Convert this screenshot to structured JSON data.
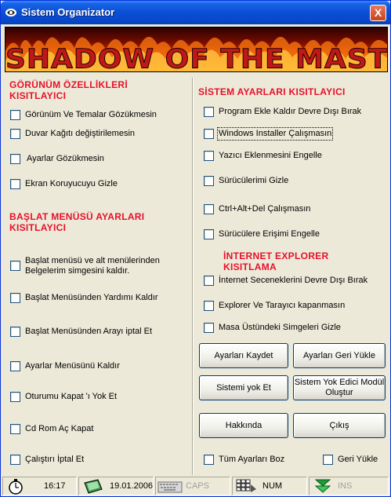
{
  "window": {
    "title": "Sistem Organizator",
    "close_label": "X"
  },
  "banner": {
    "text": "SHADOW OF THE MASTER"
  },
  "left": {
    "section1_title_line1": "GÖRÜNÜM ÖZELLİKLERİ",
    "section1_title_line2": "KISITLAYICI",
    "section1_items": [
      "Görünüm Ve Temalar Gözükmesin",
      "Duvar Kağıtı değiştirilemesin",
      "Ayarlar Gözükmesin",
      "Ekran Koruyucuyu Gizle"
    ],
    "section2_title_line1": "BAŞLAT MENÜSÜ AYARLARI",
    "section2_title_line2": "KISITLAYICI",
    "section2_item0_line1": "Başlat menüsü ve alt menülerinden",
    "section2_item0_line2": "Belgelerim simgesini kaldır.",
    "section2_items": [
      "Başlat Menüsünden Yardımı Kaldır",
      "Başlat Menüsünden Arayı iptal Et",
      "Ayarlar Menüsünü Kaldır",
      "Oturumu Kapat 'ı Yok Et",
      "Cd Rom Aç Kapat",
      "Çalıştırı İptal Et"
    ]
  },
  "right": {
    "section1_title": "SİSTEM AYARLARI KISITLAYICI",
    "section1_items": [
      "Program Ekle Kaldır  Devre Dışı Bırak",
      "Windows Installer Çalışmasın",
      "Yazıcı Eklenmesini Engelle",
      "Sürücülerimi Gizle",
      "Ctrl+Alt+Del Çalışmasın",
      "Sürücülere Erişimi Engelle"
    ],
    "section2_title_line1": "İNTERNET EXPLORER",
    "section2_title_line2": "KISITLAMA",
    "section2_items": [
      "İnternet Seceneklerini Devre Dışı Bırak",
      "Explorer Ve Tarayıcı kapanmasın",
      "Masa Üstündeki Simgeleri Gizle"
    ],
    "buttons": {
      "save": "Ayarları Kaydet",
      "restore": "Ayarları Geri Yükle",
      "destroy": "Sistemi yok Et",
      "create_line1": "Sistem Yok Edici Modül",
      "create_line2": "Oluştur",
      "about": "Hakkında",
      "exit": "Çıkış"
    },
    "reset_all": "Tüm Ayarları Boz",
    "restore_check": "Geri Yükle"
  },
  "statusbar": {
    "time": "16:17",
    "date": "19.01.2006",
    "caps": "CAPS",
    "num": "NUM",
    "ins": "INS"
  },
  "colors": {
    "section_title": "#e8102a",
    "titlebar": "#0a4fd6"
  }
}
